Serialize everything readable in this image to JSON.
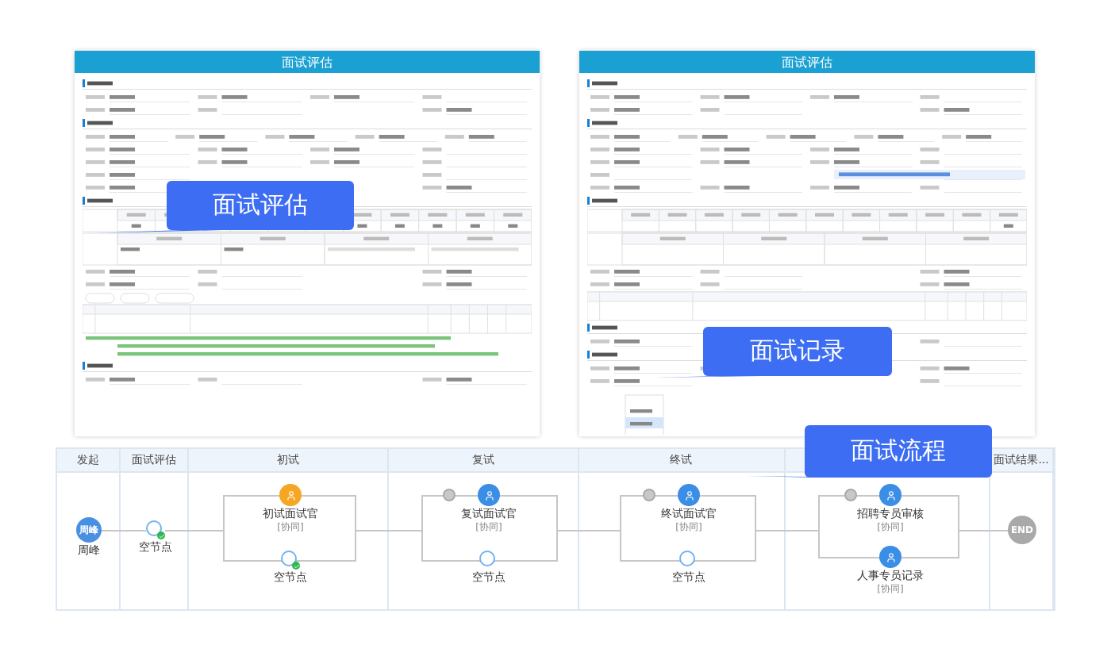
{
  "forms": [
    {
      "title": "面试评估"
    },
    {
      "title": "面试评估"
    }
  ],
  "flow": {
    "lanes": [
      {
        "title": "发起"
      },
      {
        "title": "面试评估"
      },
      {
        "title": "初试"
      },
      {
        "title": "复试"
      },
      {
        "title": "终试"
      },
      {
        "title": "面试结果..."
      }
    ],
    "nodes": [
      {
        "kind": "start",
        "badge": "周峰",
        "label": "周峰"
      },
      {
        "kind": "empty",
        "label": "空节点",
        "done": true
      },
      {
        "kind": "task",
        "label": "初试面试官",
        "sub": "[协同]",
        "color": "#f5a623",
        "gate": false
      },
      {
        "kind": "empty",
        "label": "空节点",
        "done": true
      },
      {
        "kind": "task",
        "label": "复试面试官",
        "sub": "[协同]",
        "color": "#3a8ee6",
        "gate": true
      },
      {
        "kind": "empty",
        "label": "空节点",
        "done": false
      },
      {
        "kind": "task",
        "label": "终试面试官",
        "sub": "[协同]",
        "color": "#3a8ee6",
        "gate": true
      },
      {
        "kind": "empty",
        "label": "空节点",
        "done": false
      },
      {
        "kind": "task",
        "label": "招聘专员审核",
        "sub": "[协同]",
        "color": "#3a8ee6",
        "gate": true
      },
      {
        "kind": "task",
        "label": "人事专员记录",
        "sub": "[协同]",
        "color": "#3a8ee6",
        "gate": false
      },
      {
        "kind": "end",
        "badge": "END"
      }
    ]
  },
  "callouts": [
    {
      "text": "面试评估"
    },
    {
      "text": "面试记录"
    },
    {
      "text": "面试流程"
    }
  ]
}
